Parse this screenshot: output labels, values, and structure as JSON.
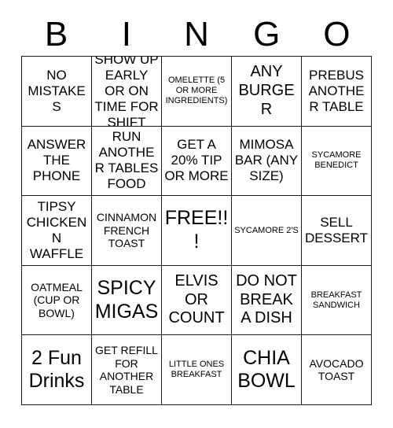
{
  "card": {
    "title": "BINGO",
    "header_letters": [
      "B",
      "I",
      "N",
      "G",
      "O"
    ],
    "colors": {
      "background": "#ffffff",
      "border": "#1a1a1a",
      "text": "#000000"
    },
    "grid_size": "5x5",
    "free_space_index": 12,
    "cells": [
      {
        "text": "NO MISTAKES",
        "size": "fs-md"
      },
      {
        "text": "SHOW UP EARLY OR ON TIME FOR SHIFT",
        "size": "fs-md"
      },
      {
        "text": "OMELETTE (5 OR MORE INGREDIENTS)",
        "size": "fs-xs"
      },
      {
        "text": "ANY BURGER",
        "size": "fs-lg"
      },
      {
        "text": "PREBUS ANOTHER TABLE",
        "size": "fs-md"
      },
      {
        "text": "ANSWER THE PHONE",
        "size": "fs-md"
      },
      {
        "text": "RUN ANOTHER TABLES FOOD",
        "size": "fs-md"
      },
      {
        "text": "GET A 20% TIP OR MORE",
        "size": "fs-md"
      },
      {
        "text": "MIMOSA BAR (ANY SIZE)",
        "size": "fs-md"
      },
      {
        "text": "SYCAMORE BENEDICT",
        "size": "fs-xs"
      },
      {
        "text": "TIPSY CHICKEN N WAFFLE",
        "size": "fs-md"
      },
      {
        "text": "CINNAMON FRENCH TOAST",
        "size": "fs-sm"
      },
      {
        "text": "FREE!!!",
        "size": "fs-xl"
      },
      {
        "text": "SYCAMORE 2'S",
        "size": "fs-xs"
      },
      {
        "text": "SELL DESSERT",
        "size": "fs-md"
      },
      {
        "text": "OATMEAL (CUP OR BOWL)",
        "size": "fs-sm"
      },
      {
        "text": "SPICY MIGAS",
        "size": "fs-xl"
      },
      {
        "text": "ELVIS OR COUNT",
        "size": "fs-lg"
      },
      {
        "text": "DO NOT BREAK A DISH",
        "size": "fs-lg"
      },
      {
        "text": "BREAKFAST SANDWICH",
        "size": "fs-xs"
      },
      {
        "text": "2 Fun Drinks",
        "size": "fs-xl"
      },
      {
        "text": "GET REFILL FOR ANOTHER TABLE",
        "size": "fs-sm"
      },
      {
        "text": "LITTLE ONES BREAKFAST",
        "size": "fs-xs"
      },
      {
        "text": "CHIA BOWL",
        "size": "fs-xl"
      },
      {
        "text": "AVOCADO TOAST",
        "size": "fs-sm"
      }
    ]
  }
}
